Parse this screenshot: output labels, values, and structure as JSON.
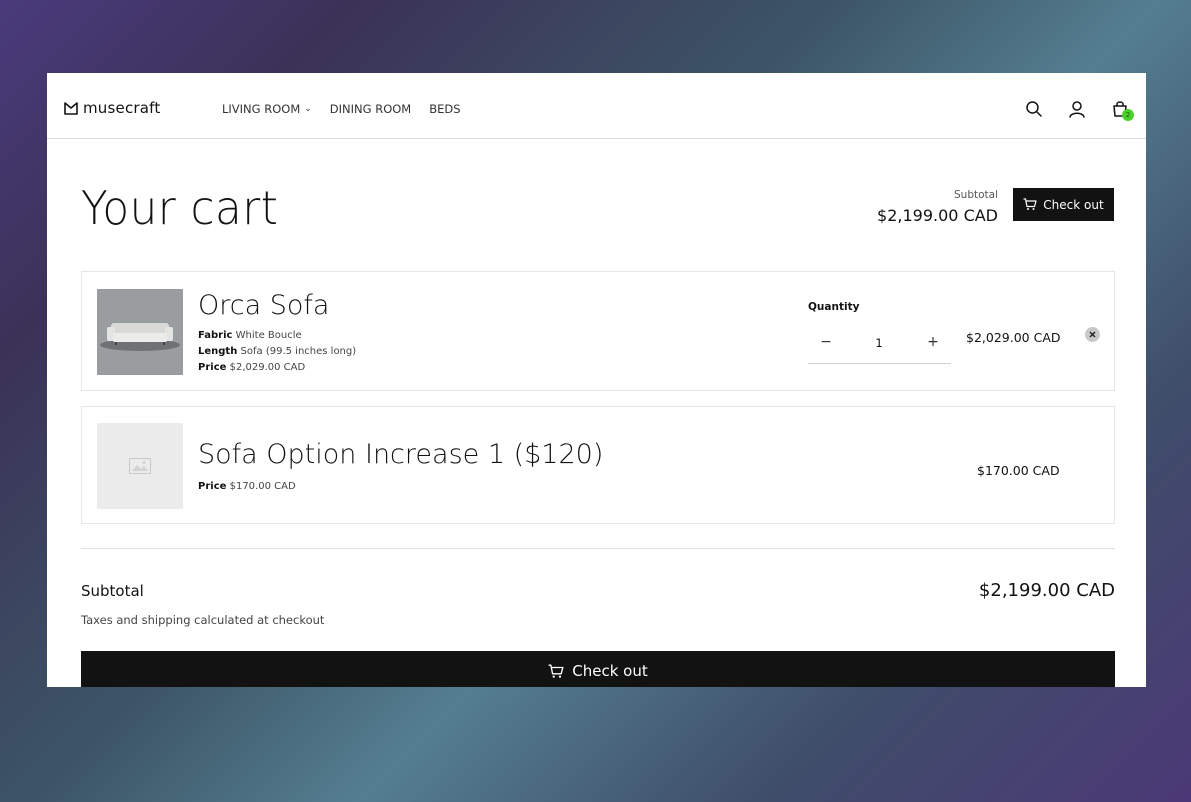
{
  "brand": {
    "name": "musecraft"
  },
  "nav": {
    "items": [
      {
        "label": "LIVING ROOM",
        "has_dropdown": true
      },
      {
        "label": "DINING ROOM",
        "has_dropdown": false
      },
      {
        "label": "BEDS",
        "has_dropdown": false
      }
    ]
  },
  "header_icons": [
    "search-icon",
    "account-icon",
    "cart-icon"
  ],
  "cart_count": "2",
  "page": {
    "title": "Your cart"
  },
  "top_summary": {
    "subtotal_label": "Subtotal",
    "subtotal_value": "$2,199.00 CAD",
    "checkout_label": "Check out"
  },
  "items": [
    {
      "name": "Orca Sofa",
      "image": "sofa-photo",
      "properties": [
        {
          "key": "Fabric",
          "value": "White Boucle"
        },
        {
          "key": "Length",
          "value": "Sofa (99.5 inches long)"
        },
        {
          "key": "Price",
          "value": "$2,029.00 CAD"
        }
      ],
      "quantity_label": "Quantity",
      "quantity": "1",
      "minus": "−",
      "plus": "+",
      "line_price": "$2,029.00 CAD"
    },
    {
      "name": "Sofa Option Increase 1 ($120)",
      "image": "image-placeholder-icon",
      "properties": [
        {
          "key": "Price",
          "value": "$170.00 CAD"
        }
      ],
      "line_price": "$170.00 CAD"
    }
  ],
  "summary": {
    "subtotal_label": "Subtotal",
    "subtotal_value": "$2,199.00 CAD",
    "tax_note": "Taxes and shipping calculated at checkout",
    "checkout_label": "Check out"
  },
  "colors": {
    "primary_button": "#121212",
    "badge": "#4cd12b",
    "border": "#e6e6e6"
  }
}
